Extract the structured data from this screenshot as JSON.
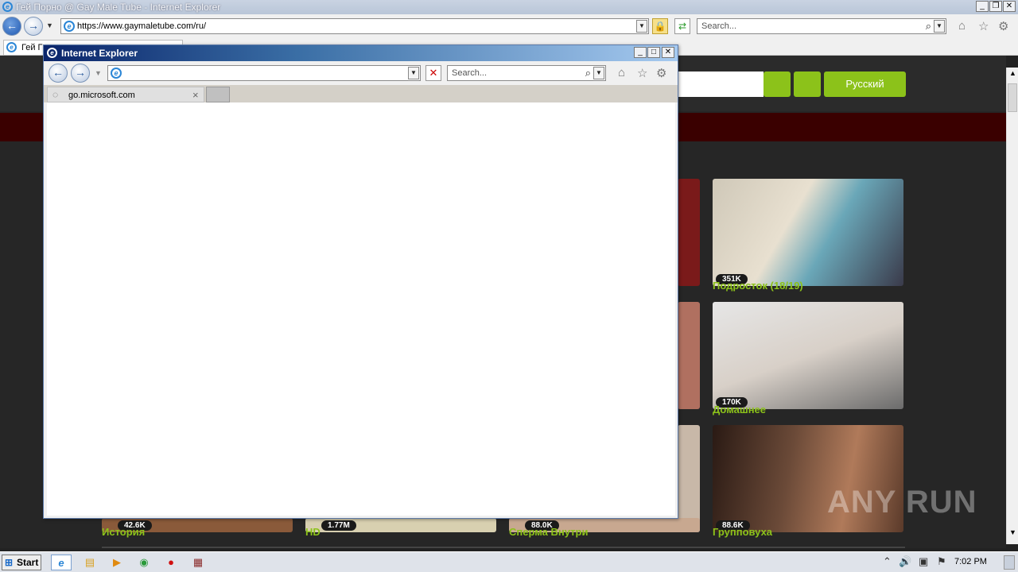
{
  "main_window": {
    "title": "Гей Порно @ Gay Male Tube - Internet Explorer",
    "address": "https://www.gaymaletube.com/ru/",
    "search_placeholder": "Search...",
    "tab_label": "Гей Г",
    "minimize": "_",
    "restore": "❐",
    "close": "✕"
  },
  "popup": {
    "title": "Internet Explorer",
    "address": "",
    "search_placeholder": "Search...",
    "tab_label": "go.microsoft.com",
    "tab_close": "×",
    "minimize": "_",
    "restore": "□",
    "close": "✕"
  },
  "site": {
    "language_button": "Русский",
    "cards": [
      {
        "views": "351K",
        "category": "Подросток (18/19)"
      },
      {
        "views": "170K",
        "category": "Домашнее"
      },
      {
        "views": "88.6K",
        "category": "Групповуха"
      },
      {
        "views": "42.6K",
        "category": "История"
      },
      {
        "views": "1.77M",
        "category": "HD"
      },
      {
        "views": "88.0K",
        "category": "Сперма Внутри"
      }
    ],
    "colors": {
      "accent": "#8cc21a",
      "background": "#262626",
      "nav": "#3a0000"
    }
  },
  "taskbar": {
    "start_label": "Start",
    "clock": "7:02 PM"
  },
  "watermark": "ANY RUN"
}
